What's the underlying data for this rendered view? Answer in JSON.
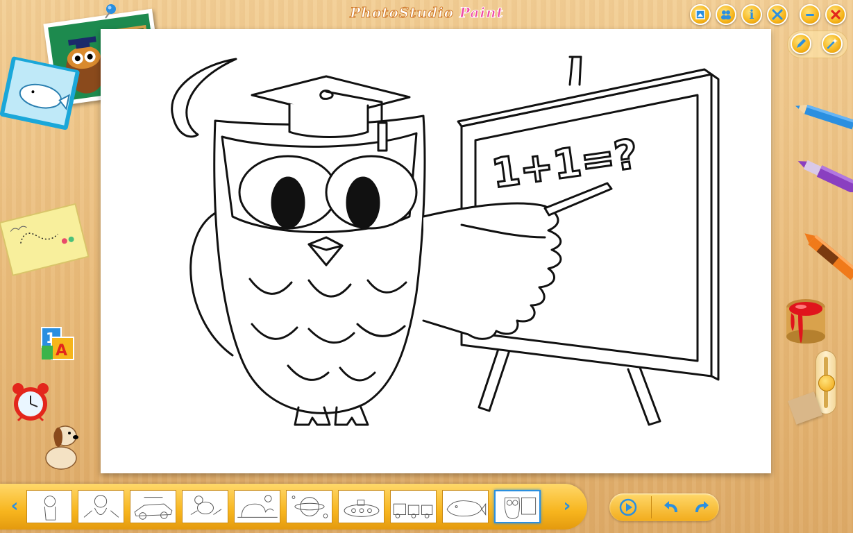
{
  "window": {
    "title_part1": "PhotoStudio",
    "title_part2": " Paint"
  },
  "top_buttons": [
    {
      "name": "picture-frame-button",
      "icon": "frame-icon"
    },
    {
      "name": "gallery-button",
      "icon": "people-icon"
    },
    {
      "name": "info-button",
      "icon": "info-icon",
      "label": "i"
    },
    {
      "name": "tools-button",
      "icon": "wrench-screwdriver-icon"
    },
    {
      "name": "minimize-button",
      "icon": "minimize-icon"
    },
    {
      "name": "close-button",
      "icon": "close-icon"
    }
  ],
  "right_tools": [
    {
      "name": "pencil-tool",
      "icon": "pencil-icon"
    },
    {
      "name": "magic-wand-tool",
      "icon": "magic-wand-icon"
    },
    {
      "name": "colored-pencil-blue",
      "color": "#2b8fe0"
    },
    {
      "name": "marker-purple",
      "color": "#8a3fc0"
    },
    {
      "name": "crayon-orange",
      "color": "#f07a1a"
    },
    {
      "name": "paint-bucket-red",
      "color": "#e0141c"
    }
  ],
  "canvas": {
    "board_text": "1+1=?"
  },
  "brush_size_slider": {
    "level": 0.5
  },
  "thumbnails": [
    {
      "name": "thumb-partial",
      "selected": false
    },
    {
      "name": "thumb-monkey",
      "selected": false
    },
    {
      "name": "thumb-car",
      "selected": false
    },
    {
      "name": "thumb-bee",
      "selected": false
    },
    {
      "name": "thumb-elephant",
      "selected": false
    },
    {
      "name": "thumb-space",
      "selected": false
    },
    {
      "name": "thumb-submarine",
      "selected": false
    },
    {
      "name": "thumb-train",
      "selected": false
    },
    {
      "name": "thumb-whale",
      "selected": false
    },
    {
      "name": "thumb-owl",
      "selected": true
    }
  ],
  "bottom_controls": [
    {
      "name": "play-button",
      "icon": "play-icon"
    },
    {
      "name": "undo-button",
      "icon": "undo-icon"
    },
    {
      "name": "redo-button",
      "icon": "redo-icon"
    }
  ],
  "colors": {
    "accent_yellow": "#f6b51b",
    "accent_blue": "#2a8fe0",
    "close_red": "#e3261c"
  }
}
